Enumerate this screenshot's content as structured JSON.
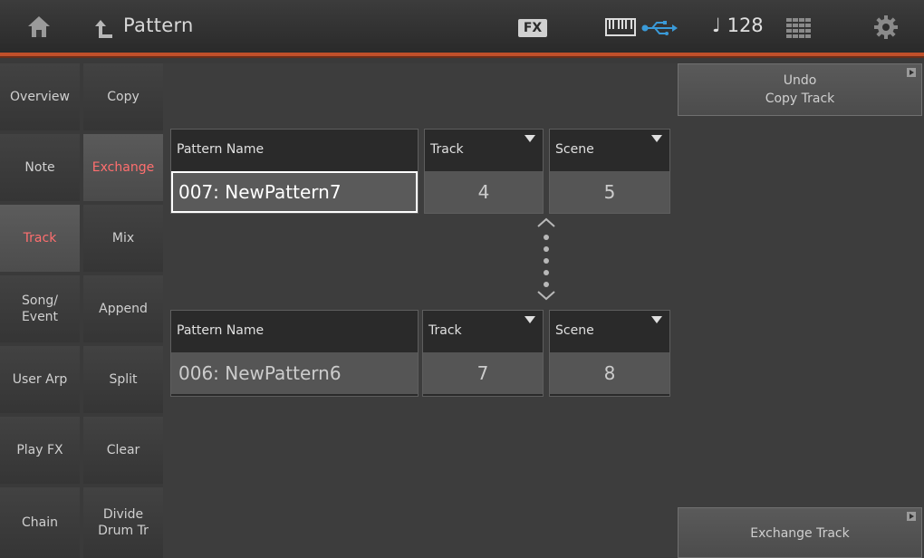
{
  "header": {
    "title": "Pattern",
    "fx_label": "FX",
    "tempo": "♩ 128",
    "icons": [
      "home-icon",
      "back-icon",
      "keyboard-icon",
      "usb-icon",
      "grid-icon",
      "gear-icon"
    ],
    "accent": "#c0502a"
  },
  "nav_col1": [
    {
      "label": "Overview"
    },
    {
      "label": "Note"
    },
    {
      "label": "Track"
    },
    {
      "label": "Song/\nEvent"
    },
    {
      "label": "User Arp"
    },
    {
      "label": "Play FX"
    },
    {
      "label": "Chain"
    }
  ],
  "nav_col2": [
    {
      "label": "Copy"
    },
    {
      "label": "Exchange"
    },
    {
      "label": "Mix"
    },
    {
      "label": "Append"
    },
    {
      "label": "Split"
    },
    {
      "label": "Clear"
    },
    {
      "label": "Divide\nDrum Tr"
    }
  ],
  "active_color": "#ff6f6f",
  "undo_button": {
    "line1": "Undo",
    "line2": "Copy Track"
  },
  "exchange_button": {
    "label": "Exchange Track"
  },
  "source": {
    "pattern_label": "Pattern Name",
    "pattern_value": "007: NewPattern7",
    "track_label": "Track",
    "track_value": "4",
    "scene_label": "Scene",
    "scene_value": "5"
  },
  "dest": {
    "pattern_label": "Pattern Name",
    "pattern_value": "006: NewPattern6",
    "track_label": "Track",
    "track_value": "7",
    "scene_label": "Scene",
    "scene_value": "8"
  }
}
